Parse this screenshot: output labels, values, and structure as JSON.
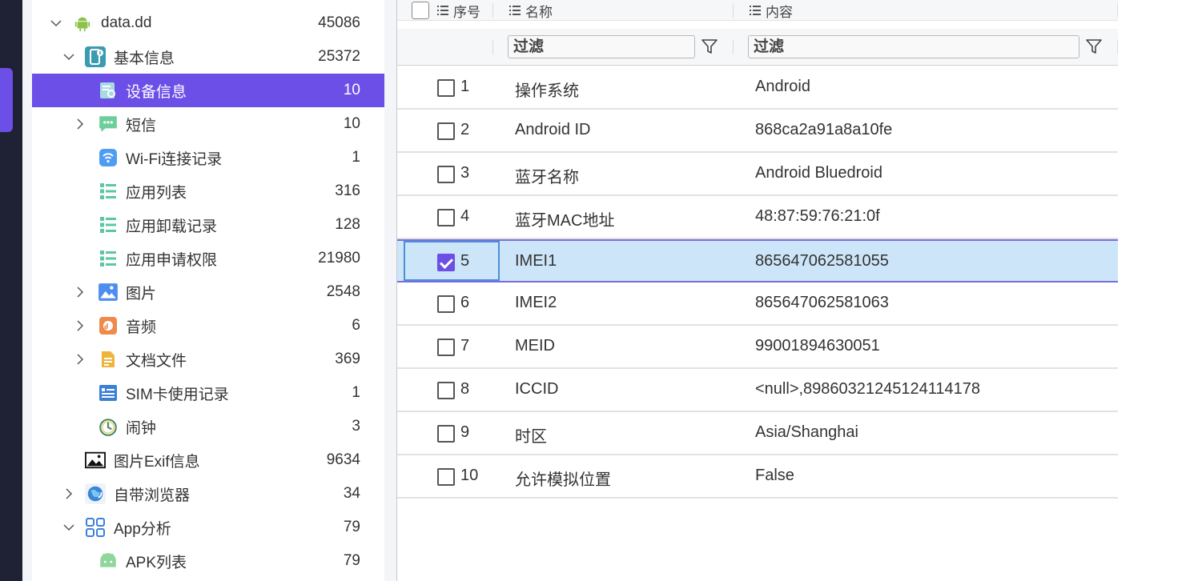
{
  "colors": {
    "accent": "#6b4fe6",
    "selected_row": "#cde5f9",
    "rail": "#1f2235"
  },
  "tree": [
    {
      "label": "data.dd",
      "count": "45086",
      "icon": "android-icon",
      "expand": "open"
    },
    {
      "label": "基本信息",
      "count": "25372",
      "icon": "phone-info-icon",
      "expand": "open"
    },
    {
      "label": "设备信息",
      "count": "10",
      "icon": "device-info-icon",
      "expand": "none",
      "selected": true
    },
    {
      "label": "短信",
      "count": "10",
      "icon": "sms-icon",
      "expand": "closed"
    },
    {
      "label": "Wi-Fi连接记录",
      "count": "1",
      "icon": "wifi-icon",
      "expand": "none"
    },
    {
      "label": "应用列表",
      "count": "316",
      "icon": "list-icon",
      "expand": "none"
    },
    {
      "label": "应用卸载记录",
      "count": "128",
      "icon": "list-icon",
      "expand": "none"
    },
    {
      "label": "应用申请权限",
      "count": "21980",
      "icon": "list-icon",
      "expand": "none"
    },
    {
      "label": "图片",
      "count": "2548",
      "icon": "image-icon",
      "expand": "closed"
    },
    {
      "label": "音频",
      "count": "6",
      "icon": "audio-icon",
      "expand": "closed"
    },
    {
      "label": "文档文件",
      "count": "369",
      "icon": "document-icon",
      "expand": "closed"
    },
    {
      "label": "SIM卡使用记录",
      "count": "1",
      "icon": "sim-icon",
      "expand": "none"
    },
    {
      "label": "闹钟",
      "count": "3",
      "icon": "alarm-clock-icon",
      "expand": "none"
    },
    {
      "label": "图片Exif信息",
      "count": "9634",
      "icon": "exif-image-icon",
      "expand": "none"
    },
    {
      "label": "自带浏览器",
      "count": "34",
      "icon": "browser-globe-icon",
      "expand": "closed"
    },
    {
      "label": "App分析",
      "count": "79",
      "icon": "app-grid-icon",
      "expand": "open"
    },
    {
      "label": "APK列表",
      "count": "79",
      "icon": "apk-android-icon",
      "expand": "none"
    }
  ],
  "grid": {
    "headers": {
      "index": "序号",
      "name": "名称",
      "content": "内容"
    },
    "filter_placeholder": "过滤",
    "rows": [
      {
        "index": "1",
        "name": "操作系统",
        "value": "Android",
        "checked": false
      },
      {
        "index": "2",
        "name": "Android ID",
        "value": "868ca2a91a8a10fe",
        "checked": false
      },
      {
        "index": "3",
        "name": "蓝牙名称",
        "value": "Android Bluedroid",
        "checked": false
      },
      {
        "index": "4",
        "name": "蓝牙MAC地址",
        "value": "48:87:59:76:21:0f",
        "checked": false
      },
      {
        "index": "5",
        "name": "IMEI1",
        "value": "865647062581055",
        "checked": true
      },
      {
        "index": "6",
        "name": "IMEI2",
        "value": "865647062581063",
        "checked": false
      },
      {
        "index": "7",
        "name": "MEID",
        "value": "99001894630051",
        "checked": false
      },
      {
        "index": "8",
        "name": "ICCID",
        "value": "<null>,89860321245124114178",
        "checked": false
      },
      {
        "index": "9",
        "name": "时区",
        "value": "Asia/Shanghai",
        "checked": false
      },
      {
        "index": "10",
        "name": "允许模拟位置",
        "value": "False",
        "checked": false
      }
    ]
  }
}
